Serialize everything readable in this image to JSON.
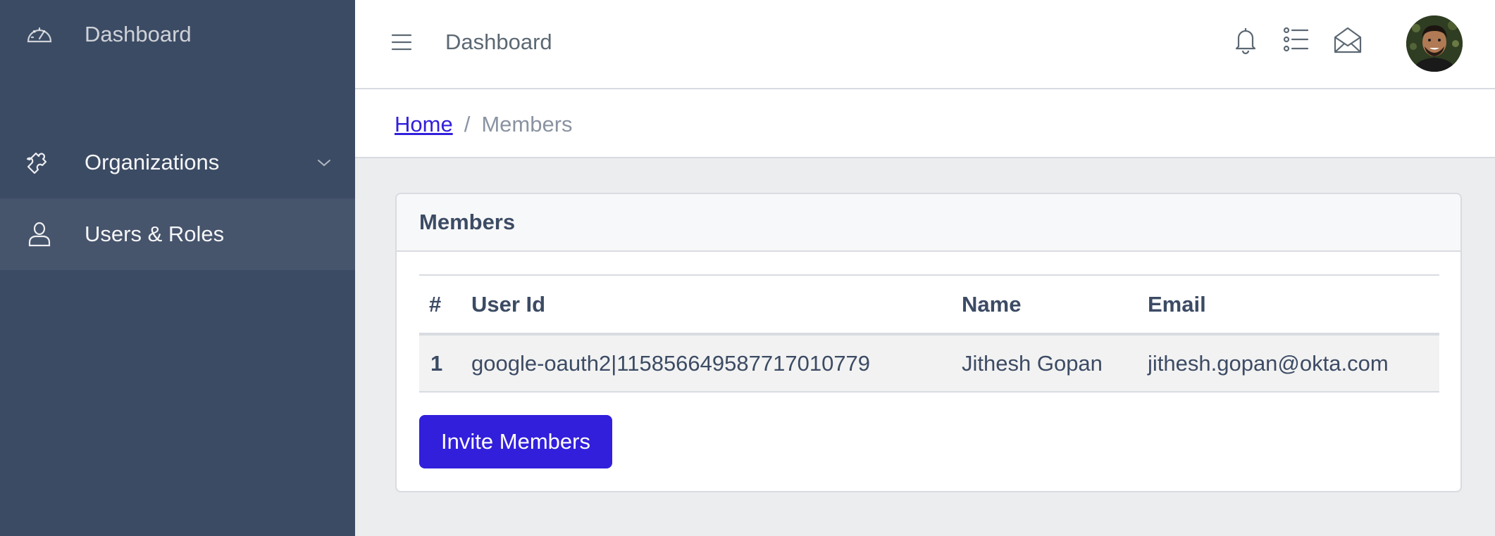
{
  "sidebar": {
    "items": [
      {
        "label": "Dashboard",
        "icon": "speedometer-icon"
      },
      {
        "label": "Organizations",
        "icon": "puzzle-icon"
      },
      {
        "label": "Users & Roles",
        "icon": "user-icon"
      }
    ]
  },
  "header": {
    "title": "Dashboard",
    "icons": [
      "menu-icon",
      "bell-icon",
      "list-icon",
      "envelope-open-icon"
    ]
  },
  "breadcrumb": {
    "home": "Home",
    "separator": "/",
    "current": "Members"
  },
  "card": {
    "title": "Members",
    "table": {
      "columns": [
        "#",
        "User Id",
        "Name",
        "Email"
      ],
      "rows": [
        {
          "num": "1",
          "user_id": "google-oauth2|115856649587717010779",
          "name": "Jithesh Gopan",
          "email": "jithesh.gopan@okta.com"
        }
      ]
    },
    "invite_button": "Invite Members"
  },
  "colors": {
    "sidebar_bg": "#3c4b64",
    "primary": "#321fdb",
    "page_bg": "#ebedef"
  }
}
